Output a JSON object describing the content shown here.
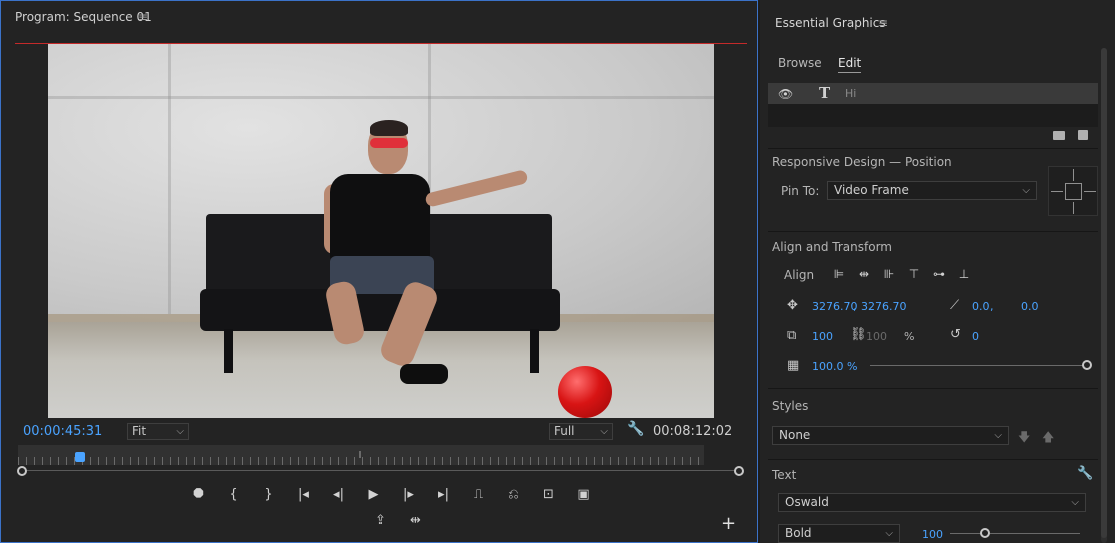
{
  "program_monitor": {
    "tab_title": "Program: Sequence 01",
    "menu_glyph": "≡",
    "timecode_current": "00:00:45:31",
    "zoom_select": "Fit",
    "resolution_select": "Full",
    "timecode_duration": "00:08:12:02",
    "transport": {
      "marker": "⯃",
      "mark_in": "{",
      "mark_out": "}",
      "go_to_in": "|◂",
      "step_back": "◂|",
      "play": "▶",
      "step_forward": "|▸",
      "go_to_out": "▸|",
      "lift": "⎍",
      "extract": "⎌",
      "export_frame": "⊡",
      "comparison": "▣",
      "export_frame_2": "⇪",
      "trim": "⇹",
      "add": "+"
    },
    "playhead_fraction": 0.09
  },
  "essential_graphics": {
    "title": "Essential Graphics",
    "menu_glyph": "≡",
    "tabs": [
      {
        "label": "Browse",
        "active": false
      },
      {
        "label": "Edit",
        "active": true
      }
    ],
    "layer": {
      "name": "Hi",
      "type_icon": "T"
    },
    "responsive_design": {
      "heading": "Responsive Design — Position",
      "pin_to_label": "Pin To:",
      "pin_to_value": "Video Frame"
    },
    "align_transform": {
      "heading": "Align and Transform",
      "align_label": "Align",
      "position_x": "3276.70",
      "position_sep": ",",
      "position_y": "3276.70",
      "anchor_x": "0.0",
      "anchor_sep": ",",
      "anchor_y": "0.0",
      "scale": "100",
      "scale_locked_value": "100",
      "scale_unit": "%",
      "rotation": "0",
      "opacity": "100.0 %"
    },
    "styles": {
      "heading": "Styles",
      "value": "None"
    },
    "text": {
      "heading": "Text",
      "font": "Oswald",
      "weight": "Bold",
      "size": "100"
    }
  },
  "colors": {
    "accent_blue": "#4aa3ff",
    "panel_border": "#3b72c8",
    "red_line": "#c42a2a"
  }
}
